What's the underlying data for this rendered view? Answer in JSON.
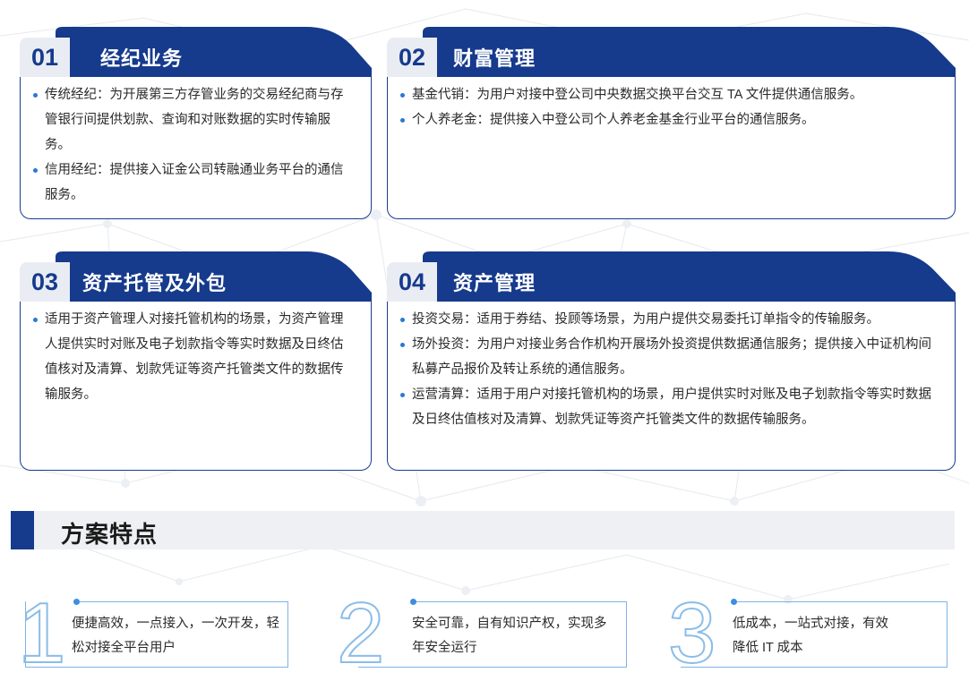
{
  "cards": [
    {
      "number": "01",
      "title": "经纪业务",
      "items": [
        "传统经纪：为开展第三方存管业务的交易经纪商与存管银行间提供划款、查询和对账数据的实时传输服务。",
        "信用经纪：提供接入证金公司转融通业务平台的通信服务。"
      ]
    },
    {
      "number": "02",
      "title": "财富管理",
      "items": [
        "基金代销：为用户对接中登公司中央数据交换平台交互 TA 文件提供通信服务。",
        "个人养老金：提供接入中登公司个人养老金基金行业平台的通信服务。"
      ]
    },
    {
      "number": "03",
      "title": "资产托管及外包",
      "items": [
        "适用于资产管理人对接托管机构的场景，为资产管理人提供实时对账及电子划款指令等实时数据及日终估值核对及清算、划款凭证等资产托管类文件的数据传输服务。"
      ]
    },
    {
      "number": "04",
      "title": "资产管理",
      "items": [
        "投资交易：适用于券结、投顾等场景，为用户提供交易委托订单指令的传输服务。",
        "场外投资：为用户对接业务合作机构开展场外投资提供数据通信服务；提供接入中证机构间私募产品报价及转让系统的通信服务。",
        "运营清算：适用于用户对接托管机构的场景，用户提供实时对账及电子划款指令等实时数据及日终估值核对及清算、划款凭证等资产托管类文件的数据传输服务。"
      ]
    }
  ],
  "section": {
    "title": "方案特点"
  },
  "features": [
    {
      "digit": "1",
      "text": "便捷高效，一点接入，一次开发，轻松对接全平台用户"
    },
    {
      "digit": "2",
      "text": "安全可靠，自有知识产权，实现多年安全运行"
    },
    {
      "digit": "3",
      "text": "低成本，一站式对接，有效降低 IT 成本"
    }
  ],
  "colors": {
    "brand": "#163a8c",
    "accent": "#2a78d6",
    "feature_outline": "#7fb3e6"
  }
}
